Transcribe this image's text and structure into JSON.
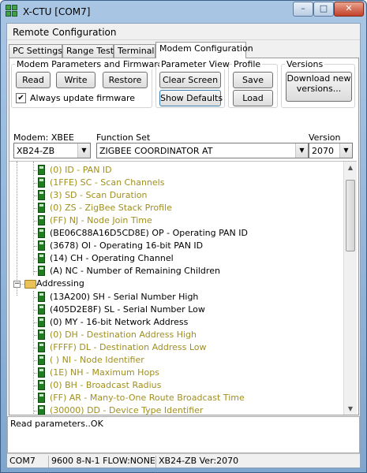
{
  "window": {
    "title": "X-CTU  [COM7]",
    "controls": [
      "–",
      "□",
      "✕"
    ]
  },
  "menu": {
    "label": "Remote Configuration"
  },
  "tabs": [
    "PC Settings",
    "Range Test",
    "Terminal",
    "Modem Configuration"
  ],
  "active_tab": "Modem Configuration",
  "groups": {
    "modem_params": "Modem Parameters and Firmware",
    "param_view": "Parameter View",
    "profile": "Profile",
    "versions": "Versions"
  },
  "buttons": {
    "read": "Read",
    "write": "Write",
    "restore": "Restore",
    "clear_screen": "Clear Screen",
    "show_defaults": "Show Defaults",
    "save": "Save",
    "load": "Load",
    "download_line1": "Download new",
    "download_line2": "versions..."
  },
  "checkbox": {
    "label": "Always update firmware",
    "checked": true
  },
  "fields": {
    "modem_label": "Modem: XBEE",
    "modem_value": "XB24-ZB",
    "function_label": "Function Set",
    "function_value": "ZIGBEE COORDINATOR AT",
    "version_label": "Version",
    "version_value": "2070"
  },
  "tree": {
    "network_items": [
      {
        "text": "(0) ID - PAN ID",
        "changed": true
      },
      {
        "text": "(1FFE) SC - Scan Channels",
        "changed": true
      },
      {
        "text": "(3) SD - Scan Duration",
        "changed": true
      },
      {
        "text": "(0) ZS - ZigBee Stack Profile",
        "changed": true
      },
      {
        "text": "(FF) NJ - Node Join Time",
        "changed": true
      },
      {
        "text": "(BE06C88A16D5CD8E) OP - Operating PAN ID",
        "changed": false
      },
      {
        "text": "(3678) OI - Operating 16-bit PAN ID",
        "changed": false
      },
      {
        "text": "(14) CH - Operating Channel",
        "changed": false
      },
      {
        "text": "(A) NC - Number of Remaining Children",
        "changed": false
      }
    ],
    "folder": {
      "label": "Addressing",
      "expander": "−"
    },
    "addressing_items": [
      {
        "text": "(13A200) SH - Serial Number High",
        "changed": false
      },
      {
        "text": "(405D2E8F) SL - Serial Number Low",
        "changed": false
      },
      {
        "text": "(0) MY - 16-bit Network Address",
        "changed": false
      },
      {
        "text": "(0) DH - Destination Address High",
        "changed": true
      },
      {
        "text": "(FFFF) DL - Destination Address Low",
        "changed": true
      },
      {
        "text": "( ) NI - Node Identifier",
        "changed": true
      },
      {
        "text": "(1E) NH - Maximum Hops",
        "changed": true
      },
      {
        "text": "(0) BH - Broadcast Radius",
        "changed": true
      },
      {
        "text": "(FF) AR - Many-to-One Route Broadcast Time",
        "changed": true
      },
      {
        "text": "(30000) DD - Device Type Identifier",
        "changed": true
      }
    ]
  },
  "status_text": "Read parameters..OK",
  "statusbar": {
    "port": "COM7",
    "settings": "9600 8-N-1  FLOW:NONE",
    "modem": "XB24-ZB  Ver:2070"
  },
  "colors": {
    "changed_param": "#a18f1c",
    "param_icon": "#1e7d1e",
    "title_gradient_top": "#a9c6e4",
    "title_gradient_bottom": "#7fa6cf"
  }
}
